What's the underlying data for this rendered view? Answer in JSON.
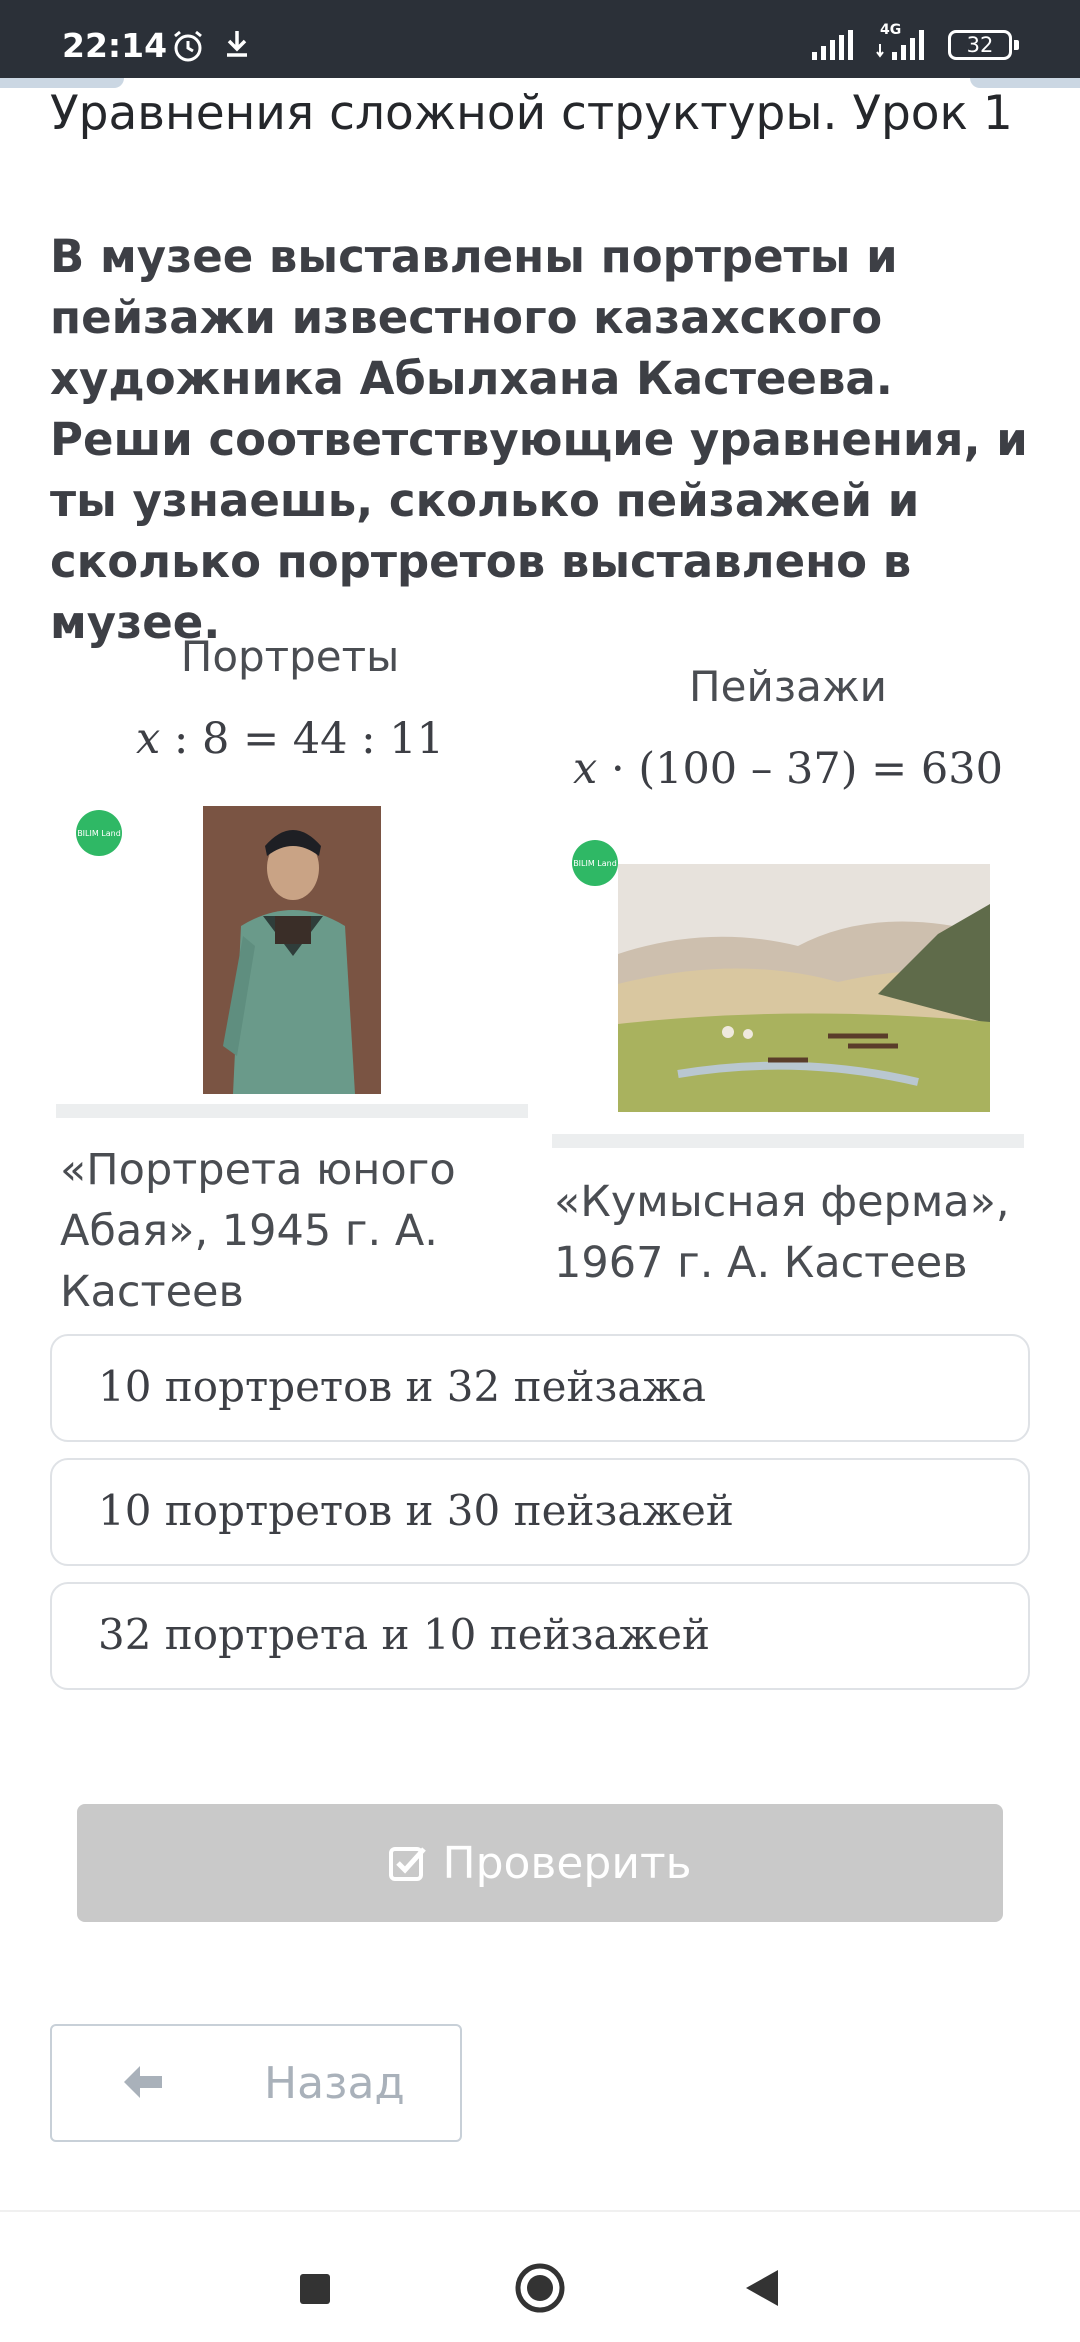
{
  "status_bar": {
    "time": "22:14",
    "network": "4G",
    "battery": "32"
  },
  "lesson": {
    "title": "Уравнения сложной структуры. Урок 1",
    "task": "В музее выставлены портреты и пейзажи известного казахского художника Абылхана Кастеева. Реши соответствующие уравнения, и ты узнаешь, сколько пейзажей и сколько портретов выставлено в музее."
  },
  "portraits": {
    "label": "Портреты",
    "equation": {
      "var": "x",
      "rest": " : 8 = 44 : 11"
    },
    "badge": "BILIM Land",
    "caption": "«Портрета юного Абая», 1945 г. А. Кастеев"
  },
  "landscapes": {
    "label": "Пейзажи",
    "equation": {
      "var": "x",
      "rest": " · (100 – 37) = 630"
    },
    "badge": "BILIM Land",
    "caption": "«Кумысная ферма», 1967 г. А. Кастеев"
  },
  "options": [
    {
      "label": "10 портретов и 32 пейзажа"
    },
    {
      "label": "10 портретов и 30 пейзажей"
    },
    {
      "label": "32 портрета и 10 пейзажей"
    }
  ],
  "buttons": {
    "check": "Проверить",
    "back": "Назад"
  },
  "colors": {
    "status_bar": "#2b3038",
    "badge": "#2fb865",
    "check_disabled": "#c9c9c9",
    "back_text": "#a9b1ba"
  },
  "icons": {
    "alarm": "alarm-icon",
    "download": "download-icon",
    "signal": "signal-icon",
    "battery": "battery-icon",
    "check": "checkbox-icon",
    "back": "arrow-left-icon",
    "nav_recents": "square-icon",
    "nav_home": "circle-icon",
    "nav_back": "triangle-icon"
  }
}
